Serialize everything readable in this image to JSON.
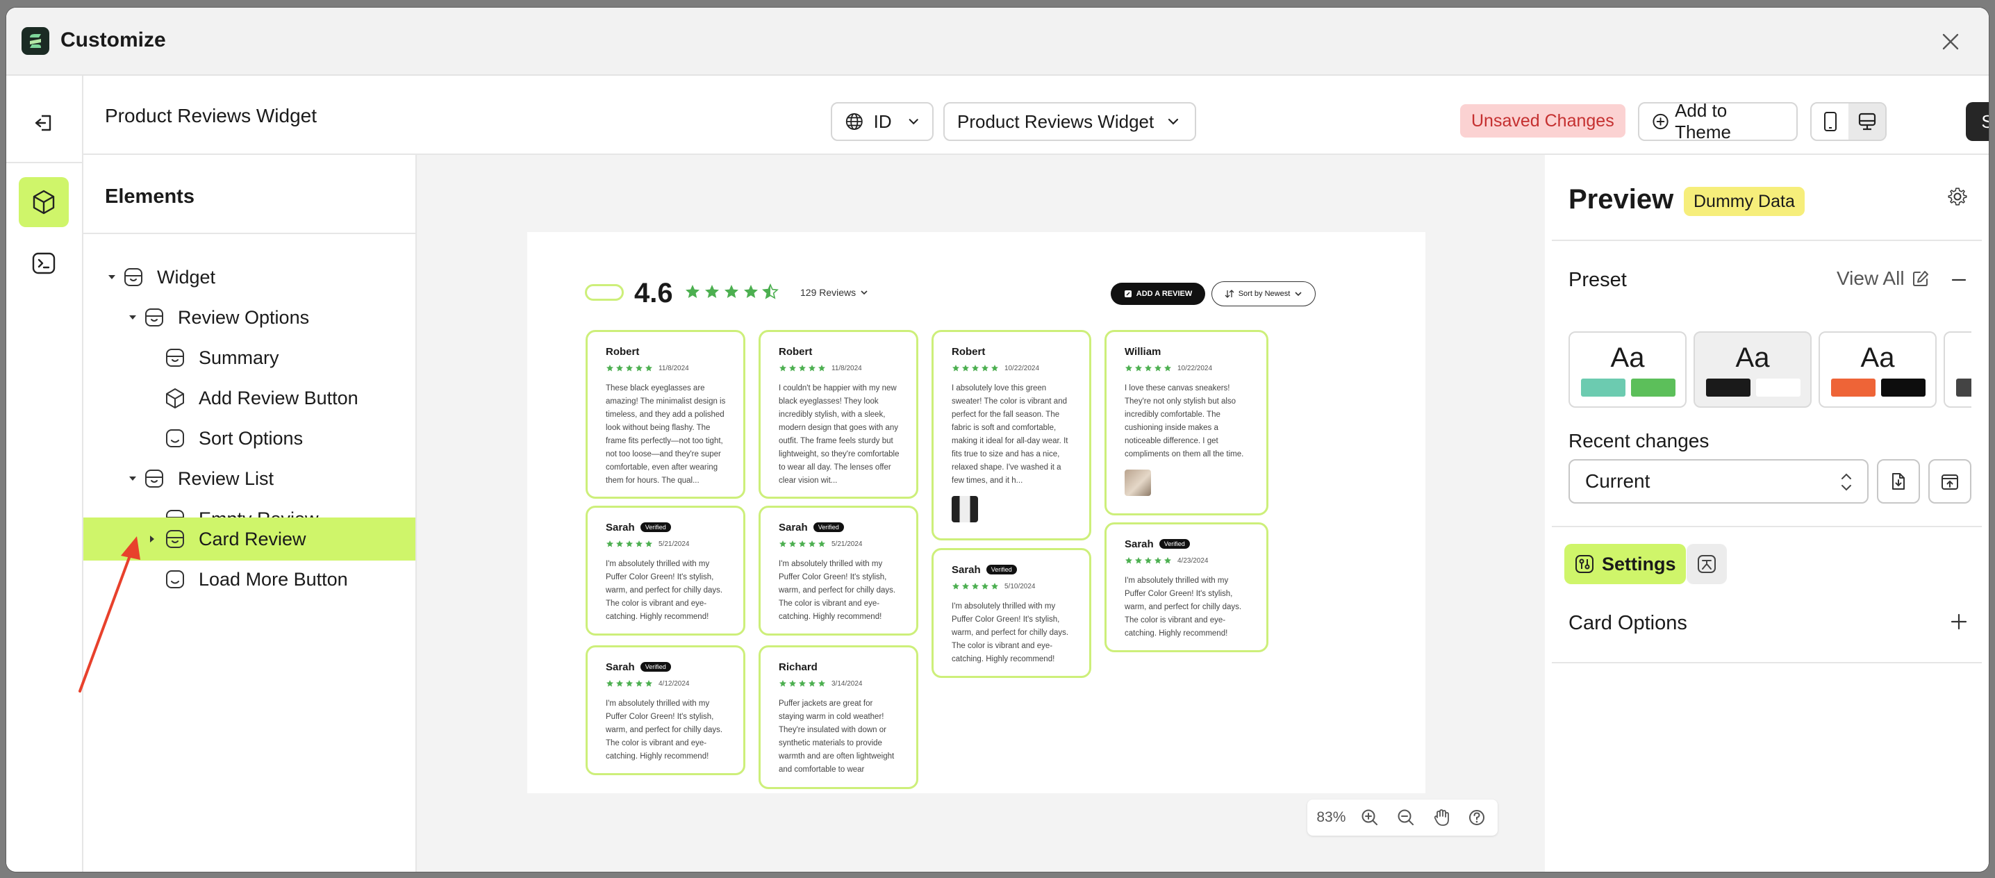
{
  "window": {
    "title": "Customize"
  },
  "toolbar": {
    "page_title": "Product Reviews Widget",
    "language": "ID",
    "widget_select": "Product Reviews Widget",
    "unsaved": "Unsaved Changes",
    "add_to_theme": "Add to Theme",
    "save": "Save"
  },
  "elements": {
    "title": "Elements",
    "items": [
      {
        "label": "Widget"
      },
      {
        "label": "Review Options"
      },
      {
        "label": "Summary"
      },
      {
        "label": "Add Review Button"
      },
      {
        "label": "Sort Options"
      },
      {
        "label": "Review List"
      },
      {
        "label": "Empty Review"
      },
      {
        "label": "Card Review"
      },
      {
        "label": "Load More Button"
      }
    ]
  },
  "widget": {
    "rating": "4.6",
    "reviews_count": "129 Reviews",
    "add_review": "ADD A REVIEW",
    "sort": "Sort by Newest",
    "verified": "Verified",
    "star_color": "#4caf50",
    "cards": [
      {
        "name": "Robert",
        "date": "11/8/2024",
        "text": "These black eyeglasses are amazing! The minimalist design is timeless, and they add a polished look without being flashy. The frame fits perfectly—not too tight, not too loose—and they're super comfortable, even after wearing them for hours. The qual..."
      },
      {
        "name": "Sarah",
        "date": "5/21/2024",
        "text": "I'm absolutely thrilled with my Puffer Color Green! It's stylish, warm, and perfect for chilly days. The color is vibrant and eye-catching. Highly recommend!"
      },
      {
        "name": "Sarah",
        "date": "4/12/2024",
        "text": "I'm absolutely thrilled with my Puffer Color Green! It's stylish, warm, and perfect for chilly days. The color is vibrant and eye-catching. Highly recommend!"
      },
      {
        "name": "Robert",
        "date": "11/8/2024",
        "text": "I couldn't be happier with my new black eyeglasses! They look incredibly stylish, with a sleek, modern design that goes with any outfit. The frame feels sturdy but lightweight, so they're comfortable to wear all day. The lenses offer clear vision wit..."
      },
      {
        "name": "Sarah",
        "date": "5/21/2024",
        "text": "I'm absolutely thrilled with my Puffer Color Green! It's stylish, warm, and perfect for chilly days. The color is vibrant and eye-catching. Highly recommend!"
      },
      {
        "name": "Richard",
        "date": "3/14/2024",
        "text": "Puffer jackets are great for staying warm in cold weather! They're insulated with down or synthetic materials to provide warmth and are often lightweight and comfortable to wear"
      },
      {
        "name": "Robert",
        "date": "10/22/2024",
        "text": "I absolutely love this green sweater! The color is vibrant and perfect for the fall season. The fabric is soft and comfortable, making it ideal for all-day wear. It fits true to size and has a nice, relaxed shape. I've washed it a few times, and it h..."
      },
      {
        "name": "Sarah",
        "date": "5/10/2024",
        "text": "I'm absolutely thrilled with my Puffer Color Green! It's stylish, warm, and perfect for chilly days. The color is vibrant and eye-catching. Highly recommend!"
      },
      {
        "name": "William",
        "date": "10/22/2024",
        "text": "I love these canvas sneakers! They're not only stylish but also incredibly comfortable. The cushioning inside makes a noticeable difference. I get compliments on them all the time."
      },
      {
        "name": "Sarah",
        "date": "4/23/2024",
        "text": "I'm absolutely thrilled with my Puffer Color Green! It's stylish, warm, and perfect for chilly days. The color is vibrant and eye-catching. Highly recommend!"
      }
    ]
  },
  "zoom": {
    "level": "83%"
  },
  "preview": {
    "title": "Preview",
    "badge": "Dummy Data",
    "preset_title": "Preset",
    "view_all": "View All",
    "presets": [
      {
        "label": "Aa",
        "c1": "#6ccbb0",
        "c2": "#5cbf5a"
      },
      {
        "label": "Aa",
        "c1": "#1a1a1a",
        "c2": "#ffffff"
      },
      {
        "label": "Aa",
        "c1": "#ee6437",
        "c2": "#0d0d0d"
      },
      {
        "label": "Aa",
        "c1": "#444444",
        "c2": "#888888"
      }
    ],
    "recent_title": "Recent changes",
    "recent_value": "Current",
    "settings_tab": "Settings",
    "card_options": "Card Options"
  },
  "colors": {
    "accent": "#cff56a",
    "card_border": "#cdef7a",
    "annotation": "#e8412c"
  }
}
